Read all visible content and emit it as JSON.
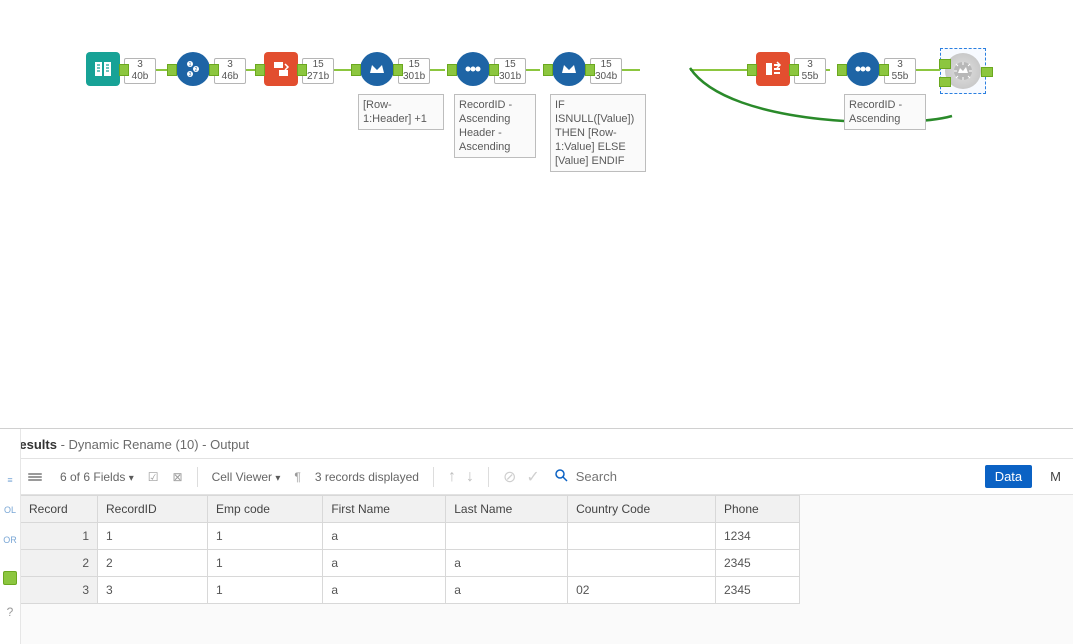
{
  "canvas": {
    "tools": [
      {
        "id": "input",
        "rows": "3",
        "bytes": "40b"
      },
      {
        "id": "recid",
        "rows": "3",
        "bytes": "46b"
      },
      {
        "id": "transpose",
        "rows": "15",
        "bytes": "271b"
      },
      {
        "id": "multirow1",
        "rows": "15",
        "bytes": "301b",
        "annot": "[Row-1:Header] +1"
      },
      {
        "id": "sort1",
        "rows": "15",
        "bytes": "301b",
        "annot": "RecordID - Ascending Header - Ascending"
      },
      {
        "id": "multirow2",
        "rows": "15",
        "bytes": "304b",
        "annot": "IF ISNULL([Value]) THEN [Row-1:Value] ELSE [Value] ENDIF"
      },
      {
        "id": "crosstab",
        "rows": "3",
        "bytes": "55b"
      },
      {
        "id": "sort2",
        "rows": "3",
        "bytes": "55b",
        "annot": "RecordID - Ascending"
      }
    ]
  },
  "results": {
    "title_prefix": "Results",
    "title_rest": " - Dynamic Rename (10) - Output",
    "fields_label": "6 of 6 Fields",
    "cell_viewer": "Cell Viewer",
    "records": "3 records displayed",
    "search_placeholder": "Search",
    "btn_data": "Data",
    "btn_m": "M",
    "gutter": [
      "OL",
      "OR"
    ],
    "headers": [
      "Record",
      "RecordID",
      "Emp code",
      "First Name",
      "Last Name",
      "Country Code",
      "Phone"
    ],
    "rows": [
      [
        "1",
        "1",
        "1",
        "a",
        "",
        "",
        "1234"
      ],
      [
        "2",
        "2",
        "1",
        "a",
        "a",
        "",
        "2345"
      ],
      [
        "3",
        "3",
        "1",
        "a",
        "a",
        "02",
        "2345"
      ]
    ]
  }
}
